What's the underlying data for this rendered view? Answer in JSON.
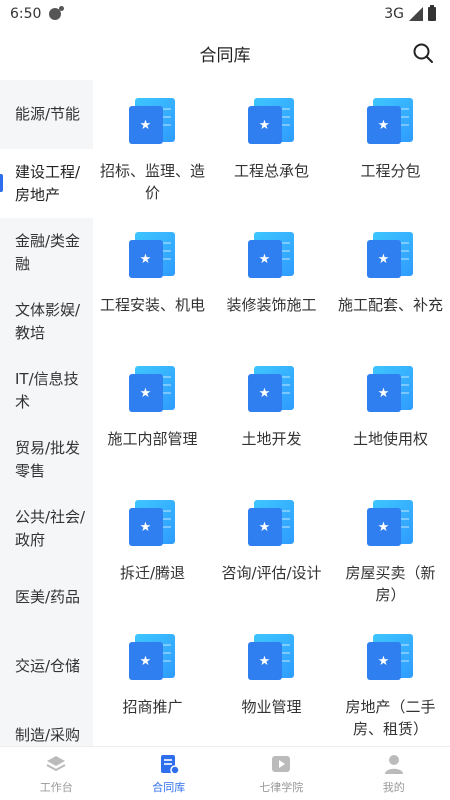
{
  "status": {
    "time": "6:50",
    "network": "3G"
  },
  "header": {
    "title": "合同库"
  },
  "sidebar": {
    "items": [
      {
        "label": "能源/节能"
      },
      {
        "label": "建设工程/房地产"
      },
      {
        "label": "金融/类金融"
      },
      {
        "label": "文体影娱/教培"
      },
      {
        "label": "IT/信息技术"
      },
      {
        "label": "贸易/批发零售"
      },
      {
        "label": "公共/社会/政府"
      },
      {
        "label": "医美/药品"
      },
      {
        "label": "交运/仓储"
      },
      {
        "label": "制造/采购"
      }
    ],
    "active_index": 1
  },
  "grid": {
    "items": [
      {
        "label": "招标、监理、造价"
      },
      {
        "label": "工程总承包"
      },
      {
        "label": "工程分包"
      },
      {
        "label": "工程安装、机电"
      },
      {
        "label": "装修装饰施工"
      },
      {
        "label": "施工配套、补充"
      },
      {
        "label": "施工内部管理"
      },
      {
        "label": "土地开发"
      },
      {
        "label": "土地使用权"
      },
      {
        "label": "拆迁/腾退"
      },
      {
        "label": "咨询/评估/设计"
      },
      {
        "label": "房屋买卖（新房）"
      },
      {
        "label": "招商推广"
      },
      {
        "label": "物业管理"
      },
      {
        "label": "房地产（二手房、租赁）"
      }
    ],
    "icon_star": "★"
  },
  "tabbar": {
    "tabs": [
      {
        "label": "工作台",
        "icon": "layers-icon"
      },
      {
        "label": "合同库",
        "icon": "document-icon"
      },
      {
        "label": "七律学院",
        "icon": "play-icon"
      },
      {
        "label": "我的",
        "icon": "user-icon"
      }
    ],
    "active_index": 1
  },
  "colors": {
    "accent": "#2f6fed",
    "icon_light": "#3ec6ff",
    "icon_dark": "#2f7ff0",
    "sidebar_bg": "#f5f6f8"
  }
}
